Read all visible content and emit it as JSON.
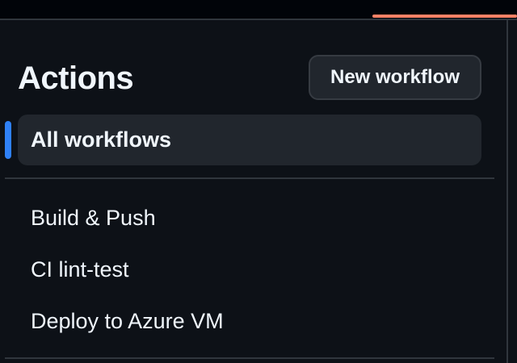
{
  "header": {
    "title": "Actions",
    "new_workflow_label": "New workflow"
  },
  "nav": {
    "all_workflows_label": "All workflows",
    "active_indicator_color": "#2f81f7"
  },
  "workflows": [
    {
      "label": "Build & Push"
    },
    {
      "label": "CI lint-test"
    },
    {
      "label": "Deploy to Azure VM"
    }
  ],
  "colors": {
    "background": "#0d1117",
    "accent_tab_underline": "#f78166",
    "selected_indicator": "#2f81f7"
  }
}
